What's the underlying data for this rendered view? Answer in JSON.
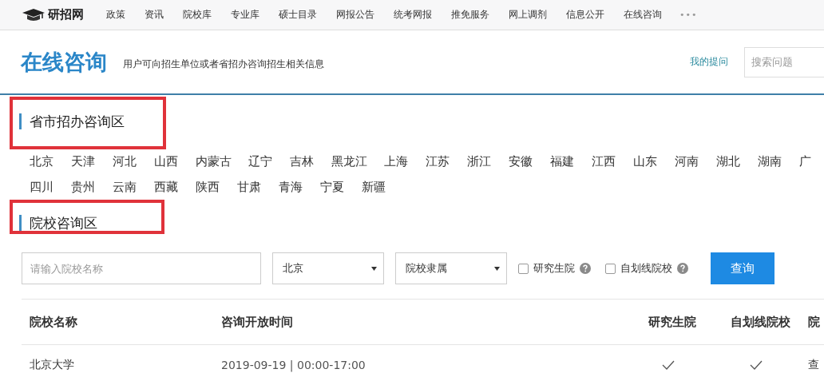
{
  "nav": {
    "logo": "研招网",
    "items": [
      "政策",
      "资讯",
      "院校库",
      "专业库",
      "硕士目录",
      "网报公告",
      "统考网报",
      "推免服务",
      "网上调剂",
      "信息公开",
      "在线咨询"
    ],
    "more": "•••"
  },
  "header": {
    "title": "在线咨询",
    "subtitle": "用户可向招生单位或者省招办咨询招生相关信息",
    "my_questions": "我的提问",
    "search": {
      "placeholder": "搜索问题"
    }
  },
  "province_section": {
    "title": "省市招办咨询区",
    "highlighted": true,
    "provinces": [
      "北京",
      "天津",
      "河北",
      "山西",
      "内蒙古",
      "辽宁",
      "吉林",
      "黑龙江",
      "上海",
      "江苏",
      "浙江",
      "安徽",
      "福建",
      "江西",
      "山东",
      "河南",
      "湖北",
      "湖南",
      "广",
      "四川",
      "贵州",
      "云南",
      "西藏",
      "陕西",
      "甘肃",
      "青海",
      "宁夏",
      "新疆"
    ]
  },
  "school_section": {
    "title": "院校咨询区",
    "highlighted": true,
    "form": {
      "name": {
        "placeholder": "请输入院校名称"
      },
      "region": {
        "value": "北京"
      },
      "affiliation": {
        "value": "院校隶属"
      },
      "checkboxes": [
        {
          "label": "研究生院",
          "checked": false
        },
        {
          "label": "自划线院校",
          "checked": false
        }
      ],
      "button": "查询"
    },
    "table": {
      "columns": [
        "院校名称",
        "咨询开放时间",
        "研究生院",
        "自划线院校",
        "院"
      ],
      "rows": [
        {
          "name": "北京大学",
          "time": "2019-09-19 | 00:00-17:00",
          "graduate_school": true,
          "self_line": true,
          "action": "查"
        }
      ]
    }
  }
}
